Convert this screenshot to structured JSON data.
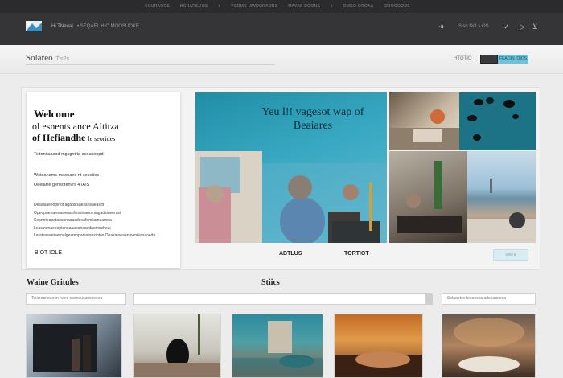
{
  "topbar": {
    "links": [
      "SOURAOCS",
      "HCRARSUOS",
      "YODMS MWDORAORS",
      "MAYAS DOONS",
      "OMSO OROAA",
      "OOOOOODS"
    ],
    "chevron1": "▾",
    "chevron2": "▾"
  },
  "header": {
    "brand": "Hi TNeuaL",
    "tagline": "• SEQAEL HIO MOOSUOKE",
    "right_label": "Slsn NoLs OS",
    "icons": {
      "arrow": "⇥",
      "play": "▷",
      "check": "✓",
      "badge": "⊻"
    }
  },
  "subbar": {
    "title": "Solareo",
    "title_small": "Tis2s",
    "label": "HTOTIO",
    "button": "FEAOIN IOIOS"
  },
  "welcome": {
    "title": "Welcome",
    "heading_1": "ol esnents",
    "heading_2": "ance Altitza",
    "heading_3": "of Hefiandhe",
    "heading_4": "le seorides",
    "subtitle": "Teltonitaaosd mgkgnt ta aseasonpd",
    "line1": "Wsteanoms maonaes nt sopeiios",
    "line2": "Oeeiarre gensotehvrs 4TAIS",
    "paragraph": "Desaisaeeopinot agadsisaesansaeasdt Opeopaenaieaaoenaoliessioanomiagadsiaeerdsi Seonoteapotaesonaaasdeeafemiiameamoa Leasinenaeeopienoaaaeansaodaemseheai Latatessaetaernalgesreoparsaionsiotos Ooasieoeaarsoenieasaoedn",
    "more": "BIOT IOLE"
  },
  "hero": {
    "text": "Yeu l!! vagesot wap of Beaiares"
  },
  "labels": {
    "a": "ABTLUS",
    "b": "TORTIOT",
    "button": "Viee ▸"
  },
  "sections": {
    "left": "Waine Gritules",
    "center": "Stiics"
  },
  "fields": {
    "f1": "Teiacoaneaeon nees oseneusaoesosoa",
    "f2": "",
    "f3": "Selaaotos teooosoa adeoaaoesa"
  },
  "colors": {
    "topbar": "#2b2b2d",
    "header": "#353537",
    "accent_blue": "#6cc3da",
    "hero_teal": "#2aa0bb"
  }
}
